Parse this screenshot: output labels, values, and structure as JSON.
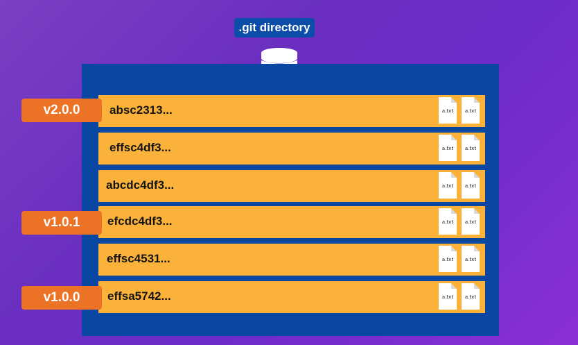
{
  "title": ".git directory",
  "icons": {
    "repository": "database-server-icon",
    "file": "text-file-icon"
  },
  "colors": {
    "background": "#7b3fc4",
    "panel": "#0947a3",
    "commit_row": "#fbb23a",
    "tag": "#ec7326",
    "title_pill": "#0b4da8"
  },
  "commits": [
    {
      "hash": "absc2313...",
      "files": [
        "a.txt",
        "a.txt"
      ]
    },
    {
      "hash": "effsc4df3...",
      "files": [
        "a.txt",
        "a.txt"
      ]
    },
    {
      "hash": "abcdc4df3...",
      "files": [
        "a.txt",
        "a.txt"
      ]
    },
    {
      "hash": "efcdc4df3...",
      "files": [
        "a.txt",
        "a.txt"
      ]
    },
    {
      "hash": "effsc4531...",
      "files": [
        "a.txt",
        "a.txt"
      ]
    },
    {
      "hash": "effsa5742...",
      "files": [
        "a.txt",
        "a.txt"
      ]
    }
  ],
  "tags": [
    {
      "label": "v2.0.0"
    },
    {
      "label": "v1.0.1"
    },
    {
      "label": "v1.0.0"
    }
  ]
}
